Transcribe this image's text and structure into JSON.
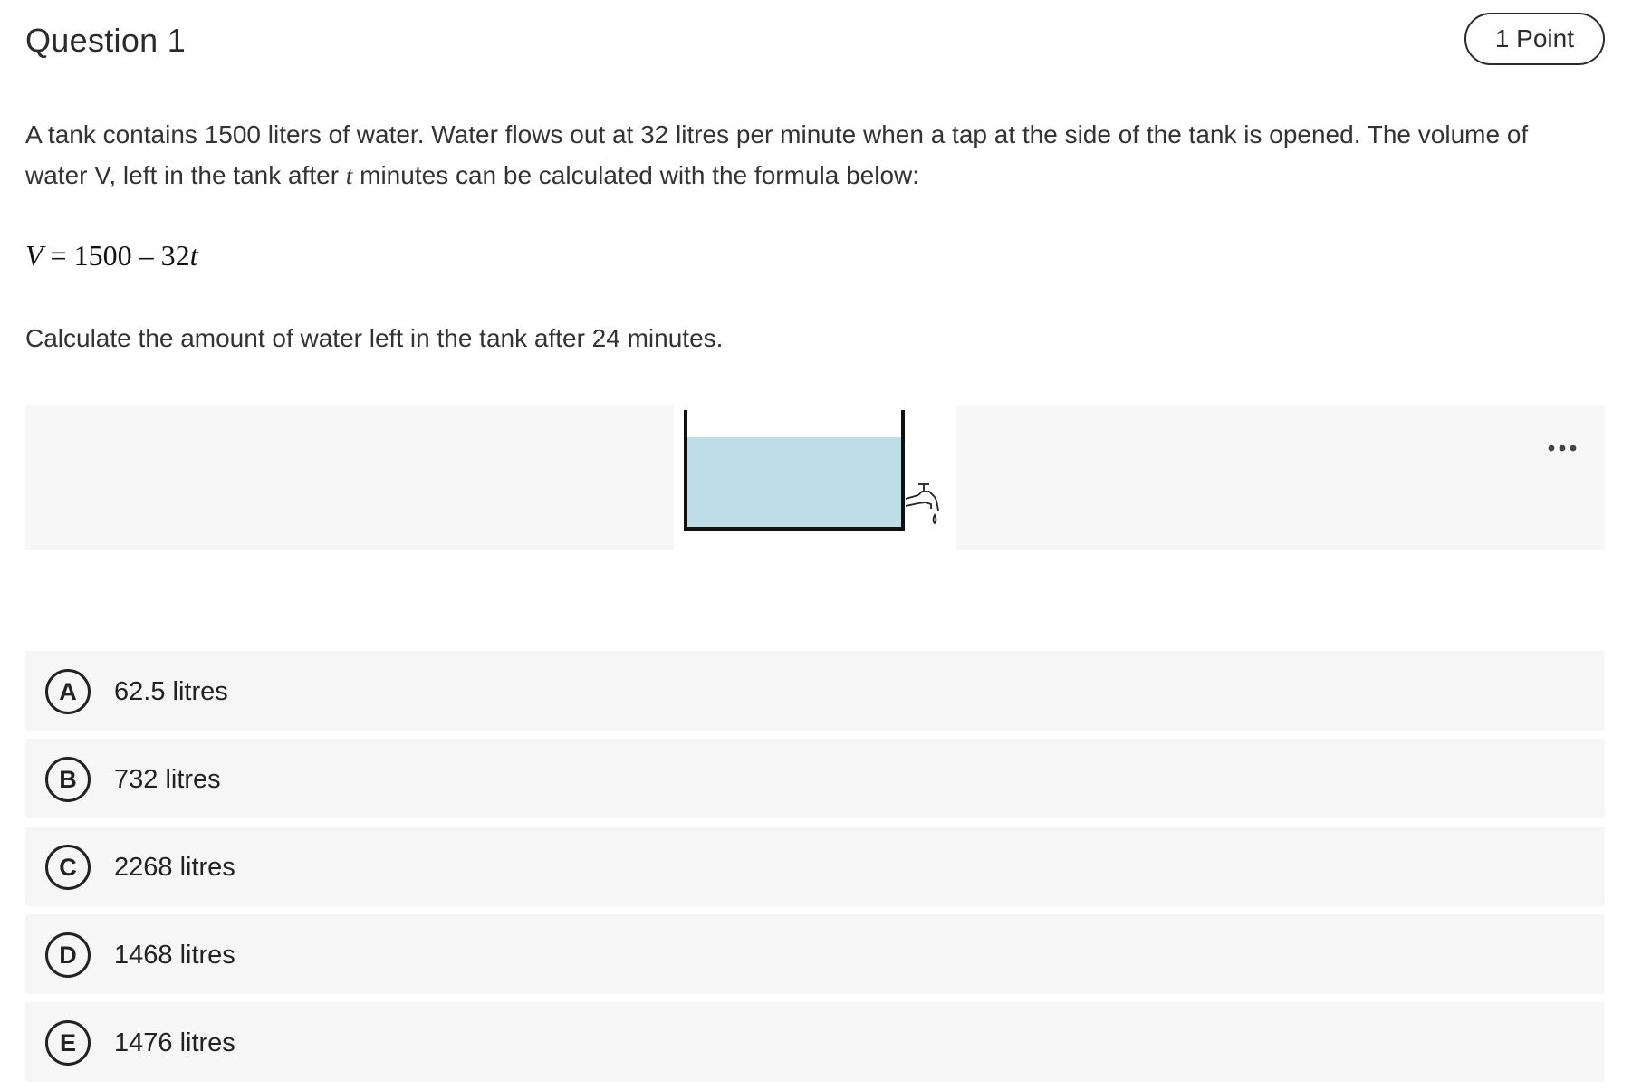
{
  "question": {
    "title": "Question 1",
    "points": "1 Point"
  },
  "prompt": {
    "part1": "A tank contains 1500 liters of water. Water flows out at 32 litres per minute when a tap at the side of the tank is opened. The volume of water V, left in the tank after ",
    "var_t": "t",
    "part2": " minutes can be calculated with the formula below:"
  },
  "formula": {
    "lhs": "V",
    "rest": " = 1500 – 32",
    "var": "t"
  },
  "instruction": "Calculate the amount of water left in the tank after 24 minutes.",
  "figure": {
    "water_color": "#bedde6",
    "more_icon": "more-horizontal-icon"
  },
  "options": [
    {
      "letter": "A",
      "text": "62.5 litres"
    },
    {
      "letter": "B",
      "text": "732 litres"
    },
    {
      "letter": "C",
      "text": "2268 litres"
    },
    {
      "letter": "D",
      "text": "1468 litres"
    },
    {
      "letter": "E",
      "text": "1476 litres"
    }
  ]
}
